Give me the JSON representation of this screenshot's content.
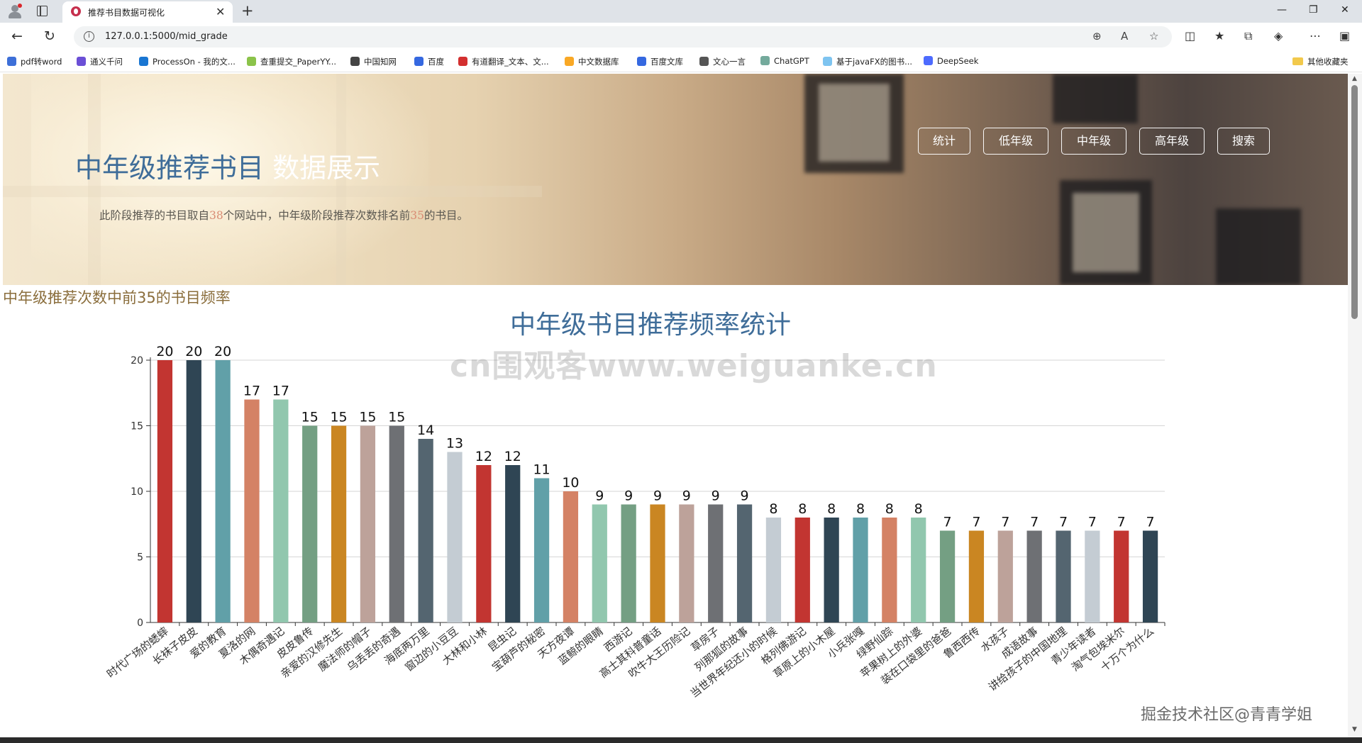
{
  "browser": {
    "tab_title": "推荐书目数据可视化",
    "url": "127.0.0.1:5000/mid_grade",
    "bookmarks": [
      "pdf转word",
      "通义千问",
      "ProcessOn - 我的文...",
      "查重提交_PaperYY...",
      "中国知网",
      "百度",
      "有道翻译_文本、文...",
      "中文数据库",
      "百度文库",
      "文心一言",
      "ChatGPT",
      "基于javaFX的图书...",
      "DeepSeek"
    ],
    "other_bookmarks": "其他收藏夹"
  },
  "hero": {
    "title_main": "中年级推荐书目",
    "title_accent": "数据展示",
    "sub_pre": "此阶段推荐的书目取自",
    "sub_num1": "38",
    "sub_mid": "个网站中，中年级阶段推荐次数排名前",
    "sub_num2": "35",
    "sub_post": "的书目。",
    "nav": [
      "统计",
      "低年级",
      "中年级",
      "高年级",
      "搜索"
    ]
  },
  "section_title": "中年级推荐次数中前35的书目频率",
  "watermark": "cn围观客www.weiguanke.cn",
  "corner_mark": "掘金技术社区@青青学姐",
  "chart_data": {
    "type": "bar",
    "title": "中年级书目推荐频率统计",
    "categories": [
      "时代广场的蟋蟀",
      "长袜子皮皮",
      "爱的教育",
      "夏洛的网",
      "木偶奇遇记",
      "皮皮鲁传",
      "亲爱的汉修先生",
      "魔法师的帽子",
      "乌丢丢的奇遇",
      "海底两万里",
      "窗边的小豆豆",
      "大林和小林",
      "昆虫记",
      "宝葫芦的秘密",
      "天方夜谭",
      "蓝鲸的眼睛",
      "西游记",
      "高士其科普童话",
      "吹牛大王历险记",
      "草房子",
      "列那狐的故事",
      "当世界年纪还小的时候",
      "格列佛游记",
      "草原上的小木屋",
      "小兵张嘎",
      "绿野仙踪",
      "苹果树上的外婆",
      "装在口袋里的爸爸",
      "鲁西西传",
      "水孩子",
      "成语故事",
      "讲给孩子的中国地理",
      "青少年读者",
      "淘气包埃米尔",
      "十万个为什么"
    ],
    "values": [
      20,
      20,
      20,
      17,
      17,
      15,
      15,
      15,
      15,
      14,
      13,
      12,
      12,
      11,
      10,
      9,
      9,
      9,
      9,
      9,
      9,
      8,
      8,
      8,
      8,
      8,
      8,
      7,
      7,
      7,
      7,
      7,
      7,
      7,
      7
    ],
    "ylim": [
      0,
      20
    ],
    "yticks": [
      0,
      5,
      10,
      15,
      20
    ],
    "palette": [
      "#c23531",
      "#2f4554",
      "#61a0a8",
      "#d48265",
      "#91c7ae",
      "#749f83",
      "#ca8622",
      "#bda29a",
      "#6e7074",
      "#546570",
      "#c4ccd3"
    ],
    "title_color": "#3f6d99",
    "grid": true,
    "legend": "none"
  }
}
